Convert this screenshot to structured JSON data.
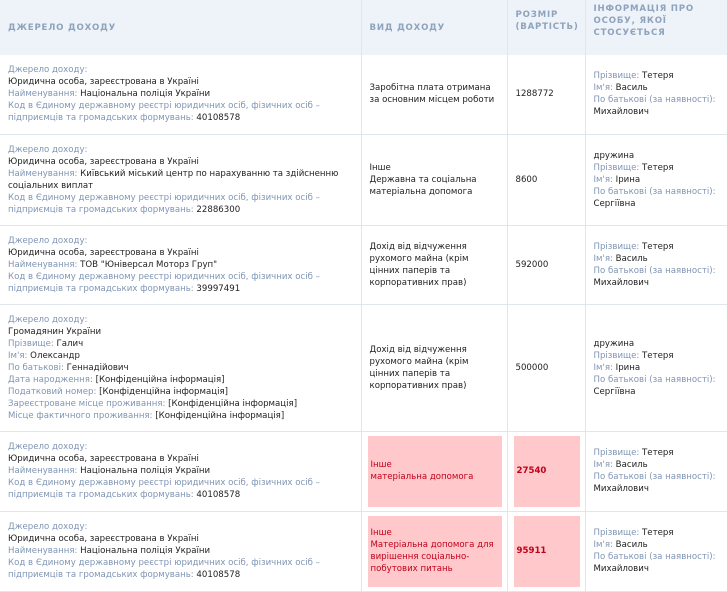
{
  "headers": {
    "source": "ДЖЕРЕЛО ДОХОДУ",
    "type": "ВИД ДОХОДУ",
    "amount_1": "РОЗМІР",
    "amount_2": "(ВАРТІСТЬ)",
    "person_1": "ІНФОРМАЦІЯ ПРО",
    "person_2": "ОСОБУ, ЯКОЇ",
    "person_3": "СТОСУЄТЬСЯ"
  },
  "rows": [
    {
      "source": [
        {
          "label": "Джерело доходу:",
          "value": ""
        },
        {
          "label": "",
          "value": "Юридична особа, зареєстрована в Україні"
        },
        {
          "label": "Найменування:",
          "value": " Національна поліція України"
        },
        {
          "label": "Код в Єдиному державному реєстрі юридичних осіб, фізичних осіб – підприємців та громадських формувань:",
          "value": " 40108578"
        }
      ],
      "type": [
        "Заробітна плата отримана за основним місцем роботи"
      ],
      "amount": "1288772",
      "person": [
        {
          "label": "Прізвище:",
          "value": " Тетеря"
        },
        {
          "label": "Ім'я:",
          "value": " Василь"
        },
        {
          "label": "По батькові (за наявності):",
          "value": ""
        },
        {
          "label": "",
          "value": "Михайлович"
        }
      ]
    },
    {
      "source": [
        {
          "label": "Джерело доходу:",
          "value": ""
        },
        {
          "label": "",
          "value": "Юридична особа, зареєстрована в Україні"
        },
        {
          "label": "Найменування:",
          "value": " Київський міський центр по нарахуванню та здійсненню соціальних виплат"
        },
        {
          "label": "Код в Єдиному державному реєстрі юридичних осіб, фізичних осіб – підприємців та громадських формувань:",
          "value": " 22886300"
        }
      ],
      "type": [
        "Інше",
        "Державна та соціальна матеріальна допомога"
      ],
      "amount": "8600",
      "person": [
        {
          "label": "",
          "value": "дружина"
        },
        {
          "label": "Прізвище:",
          "value": " Тетеря"
        },
        {
          "label": "Ім'я:",
          "value": " Ірина"
        },
        {
          "label": "По батькові (за наявності):",
          "value": ""
        },
        {
          "label": "",
          "value": "Сергіївна"
        }
      ]
    },
    {
      "source": [
        {
          "label": "Джерело доходу:",
          "value": ""
        },
        {
          "label": "",
          "value": "Юридична особа, зареєстрована в Україні"
        },
        {
          "label": "Найменування:",
          "value": " ТОВ \"Юніверсал Моторз Груп\""
        },
        {
          "label": "Код в Єдиному державному реєстрі юридичних осіб, фізичних осіб – підприємців та громадських формувань:",
          "value": " 39997491"
        }
      ],
      "type": [
        "Дохід від відчуження рухомого майна (крім цінних паперів та корпоративних прав)"
      ],
      "amount": "592000",
      "person": [
        {
          "label": "Прізвище:",
          "value": " Тетеря"
        },
        {
          "label": "Ім'я:",
          "value": " Василь"
        },
        {
          "label": "По батькові (за наявності):",
          "value": ""
        },
        {
          "label": "",
          "value": "Михайлович"
        }
      ]
    },
    {
      "source": [
        {
          "label": "Джерело доходу:",
          "value": ""
        },
        {
          "label": "",
          "value": "Громадянин України"
        },
        {
          "label": "Прізвище:",
          "value": " Галич"
        },
        {
          "label": "Ім'я:",
          "value": " Олександр"
        },
        {
          "label": "По батькові:",
          "value": " Геннадійович"
        },
        {
          "label": "Дата народження:",
          "value": " [Конфіденційна інформація]"
        },
        {
          "label": "Податковий номер:",
          "value": " [Конфіденційна інформація]"
        },
        {
          "label": "Зареєстроване місце проживання:",
          "value": " [Конфіденційна інформація]"
        },
        {
          "label": "Місце фактичного проживання:",
          "value": " [Конфіденційна інформація]"
        }
      ],
      "type": [
        "Дохід від відчуження рухомого майна (крім цінних паперів та корпоративних прав)"
      ],
      "amount": "500000",
      "person": [
        {
          "label": "",
          "value": "дружина"
        },
        {
          "label": "Прізвище:",
          "value": " Тетеря"
        },
        {
          "label": "Ім'я:",
          "value": " Ірина"
        },
        {
          "label": "По батькові (за наявності):",
          "value": ""
        },
        {
          "label": "",
          "value": "Сергіївна"
        }
      ]
    },
    {
      "source": [
        {
          "label": "Джерело доходу:",
          "value": ""
        },
        {
          "label": "",
          "value": "Юридична особа, зареєстрована в Україні"
        },
        {
          "label": "Найменування:",
          "value": " Національна поліція України"
        },
        {
          "label": "Код в Єдиному державному реєстрі юридичних осіб, фізичних осіб – підприємців та громадських формувань:",
          "value": " 40108578"
        }
      ],
      "type": [
        "Інше",
        "матеріальна допомога"
      ],
      "amount": "27540",
      "highlight": true,
      "person": [
        {
          "label": "Прізвище:",
          "value": " Тетеря"
        },
        {
          "label": "Ім'я:",
          "value": " Василь"
        },
        {
          "label": "По батькові (за наявності):",
          "value": ""
        },
        {
          "label": "",
          "value": "Михайлович"
        }
      ]
    },
    {
      "source": [
        {
          "label": "Джерело доходу:",
          "value": ""
        },
        {
          "label": "",
          "value": "Юридична особа, зареєстрована в Україні"
        },
        {
          "label": "Найменування:",
          "value": " Національна поліція України"
        },
        {
          "label": "Код в Єдиному державному реєстрі юридичних осіб, фізичних осіб – підприємців та громадських формувань:",
          "value": " 40108578"
        }
      ],
      "type": [
        "Інше",
        "Матеріальна допомога для вирішення соціально-побутових питань"
      ],
      "amount": "95911",
      "highlight": true,
      "person": [
        {
          "label": "Прізвище:",
          "value": " Тетеря"
        },
        {
          "label": "Ім'я:",
          "value": " Василь"
        },
        {
          "label": "По батькові (за наявності):",
          "value": ""
        },
        {
          "label": "",
          "value": "Михайлович"
        }
      ]
    }
  ],
  "colors": {
    "header_bg": "#eef3f9",
    "header_text": "#8fa3bd",
    "label_text": "#7f95b4",
    "highlight_bg": "#ffc9cb",
    "highlight_text": "#c0001a"
  }
}
